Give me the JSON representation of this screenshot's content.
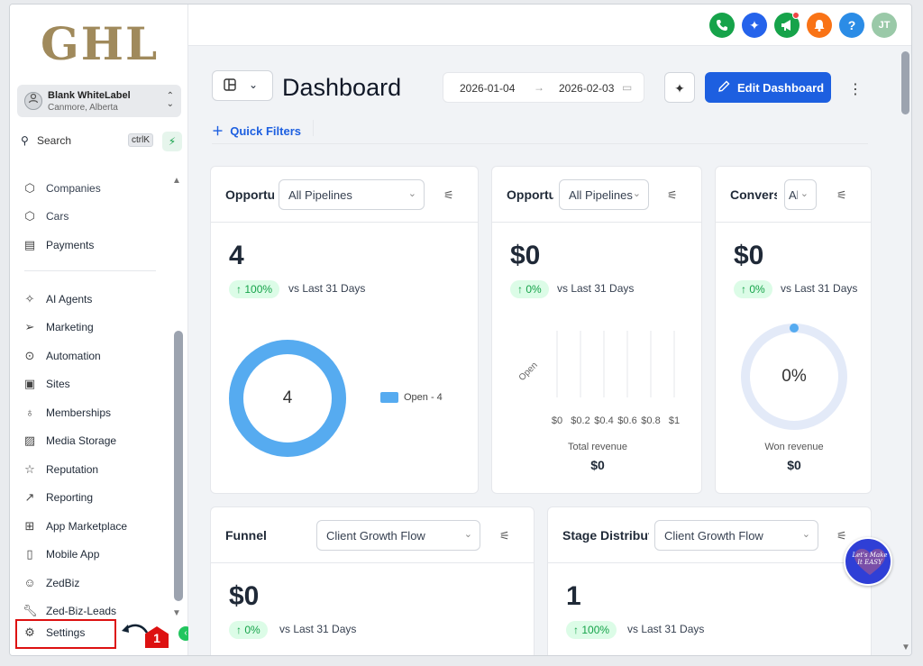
{
  "brand": {
    "logo_text": "GHL"
  },
  "account": {
    "name": "Blank WhiteLabel",
    "location": "Canmore, Alberta"
  },
  "search": {
    "label": "Search",
    "shortcut": "ctrlK"
  },
  "sidebar": {
    "items_top": [
      {
        "label": "Companies",
        "icon": "building-icon"
      },
      {
        "label": "Cars",
        "icon": "cube-icon"
      },
      {
        "label": "Payments",
        "icon": "receipt-icon"
      }
    ],
    "items": [
      {
        "label": "AI Agents",
        "icon": "sparkles-icon"
      },
      {
        "label": "Marketing",
        "icon": "send-icon"
      },
      {
        "label": "Automation",
        "icon": "automation-icon"
      },
      {
        "label": "Sites",
        "icon": "sites-icon"
      },
      {
        "label": "Memberships",
        "icon": "award-icon"
      },
      {
        "label": "Media Storage",
        "icon": "image-icon"
      },
      {
        "label": "Reputation",
        "icon": "star-icon"
      },
      {
        "label": "Reporting",
        "icon": "trend-icon"
      },
      {
        "label": "App Marketplace",
        "icon": "grid-icon"
      },
      {
        "label": "Mobile App",
        "icon": "phone-icon"
      },
      {
        "label": "ZedBiz",
        "icon": "chat-icon"
      },
      {
        "label": "Zed-Biz-Leads",
        "icon": "wrench-icon"
      }
    ],
    "settings_label": "Settings",
    "annotation_number": "1"
  },
  "topbar": {
    "icons": [
      {
        "name": "phone-icon",
        "color": "#16a34a"
      },
      {
        "name": "magic-icon",
        "color": "#2563eb"
      },
      {
        "name": "megaphone-icon",
        "color": "#16a34a"
      },
      {
        "name": "bell-icon",
        "color": "#f97316"
      },
      {
        "name": "help-icon",
        "color": "#2b8ce6"
      },
      {
        "name": "avatar",
        "color": "#9ac9a8"
      }
    ],
    "help_label": "?",
    "avatar_initials": "JT"
  },
  "header": {
    "title": "Dashboard",
    "date_start": "2026-01-04",
    "date_end": "2026-02-03",
    "edit_label": "Edit Dashboard",
    "quick_filters_label": "Quick Filters"
  },
  "cards": {
    "opp_value": {
      "title": "Opportunities",
      "select": "All Pipelines",
      "value": "4",
      "change": "100%",
      "vs": "vs Last 31 Days",
      "donut_value": "4",
      "legend": "Open - 4"
    },
    "opp_revenue": {
      "title": "Opportunity Value",
      "select": "All Pipelines",
      "value": "$0",
      "change": "0%",
      "vs": "vs Last 31 Days",
      "bar_category": "Open",
      "x_ticks": [
        "$0",
        "$0.2",
        "$0.4",
        "$0.6",
        "$0.8",
        "$1"
      ],
      "total_label": "Total revenue",
      "total_value": "$0"
    },
    "conversion": {
      "title": "Conversion",
      "select": "All",
      "value": "$0",
      "change": "0%",
      "vs": "vs Last 31 Days",
      "gauge_value": "0%",
      "won_label": "Won revenue",
      "won_value": "$0"
    },
    "funnel": {
      "title": "Funnel",
      "select": "Client Growth Flow",
      "value": "$0",
      "change": "0%",
      "vs": "vs Last 31 Days"
    },
    "stage": {
      "title": "Stage Distribution",
      "select": "Client Growth Flow",
      "value": "1",
      "change": "100%",
      "vs": "vs Last 31 Days"
    }
  },
  "bubble": {
    "text": "Let's Make It EASY"
  },
  "colors": {
    "accent": "#1d5fe0",
    "positive": "#16a34a",
    "donut": "#56abf0",
    "annotation": "#dd1111"
  }
}
